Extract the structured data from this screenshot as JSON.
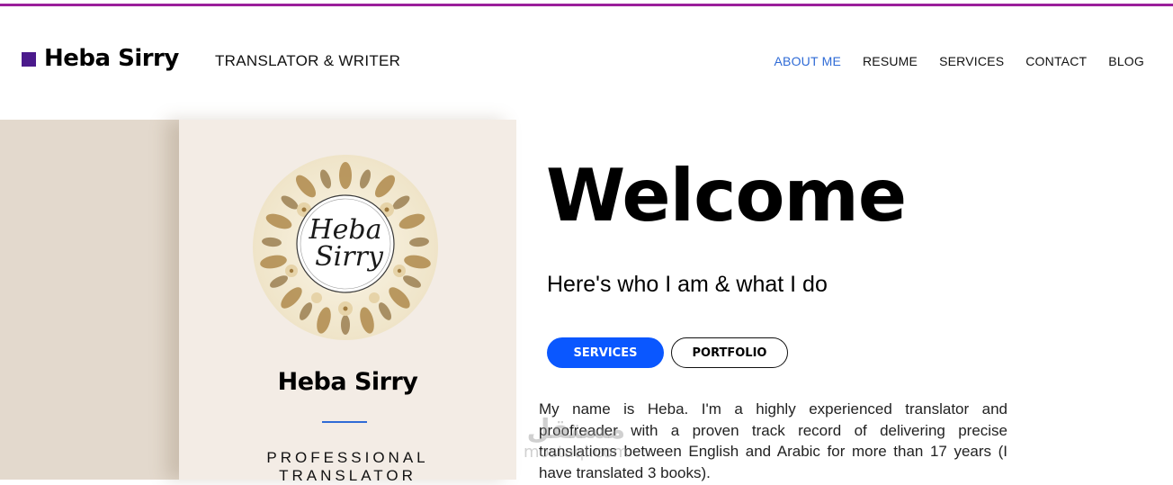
{
  "header": {
    "brand_name": "Heba Sirry",
    "tagline": "TRANSLATOR & WRITER",
    "nav": [
      {
        "label": "ABOUT ME",
        "active": true
      },
      {
        "label": "RESUME",
        "active": false
      },
      {
        "label": "SERVICES",
        "active": false
      },
      {
        "label": "CONTACT",
        "active": false
      },
      {
        "label": "BLOG",
        "active": false
      }
    ]
  },
  "profile": {
    "logo_text_line1": "Heba",
    "logo_text_line2": "Sirry",
    "name": "Heba Sirry",
    "title_line1": "PROFESSIONAL",
    "title_line2": "TRANSLATOR"
  },
  "main": {
    "heading": "Welcome",
    "subtitle": "Here's who I am & what I do",
    "services_button": "SERVICES",
    "portfolio_button": "PORTFOLIO",
    "intro": "My name is Heba. I'm a highly experienced translator and proofreader with a proven track record of delivering precise translations between English and Arabic for more than 17 years (I have translated 3 books)."
  },
  "watermark": {
    "arabic": "مستقل",
    "latin": "mostaql.com"
  },
  "colors": {
    "accent_blue": "#0a57ff",
    "nav_active": "#2f6bd6",
    "brand_square": "#4b1a8c",
    "top_line": "#9b1f9b",
    "card_bg": "#f3ece5",
    "shade_bg": "#e3d9cd"
  }
}
